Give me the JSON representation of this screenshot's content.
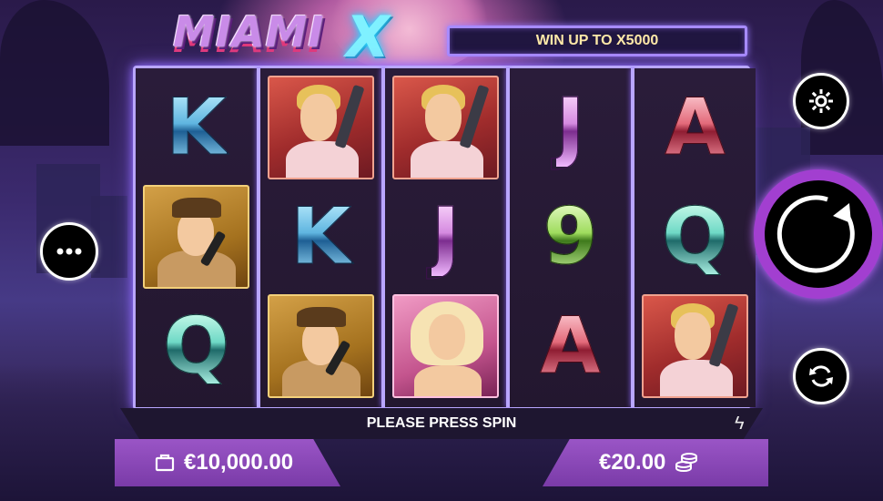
{
  "game": {
    "logo_main": "MIAMI",
    "logo_x": "X",
    "banner": "WIN UP TO X5000"
  },
  "reels": [
    [
      {
        "type": "letter",
        "value": "K"
      },
      {
        "type": "character",
        "name": "cop"
      },
      {
        "type": "letter",
        "value": "Q"
      }
    ],
    [
      {
        "type": "character",
        "name": "mobster"
      },
      {
        "type": "letter",
        "value": "K"
      },
      {
        "type": "character",
        "name": "cop"
      }
    ],
    [
      {
        "type": "character",
        "name": "mobster"
      },
      {
        "type": "letter",
        "value": "J"
      },
      {
        "type": "character",
        "name": "lady"
      }
    ],
    [
      {
        "type": "letter",
        "value": "J"
      },
      {
        "type": "letter",
        "value": "9"
      },
      {
        "type": "letter",
        "value": "A"
      }
    ],
    [
      {
        "type": "letter",
        "value": "A"
      },
      {
        "type": "letter",
        "value": "Q"
      },
      {
        "type": "character",
        "name": "mobster"
      }
    ]
  ],
  "status": {
    "message": "PLEASE PRESS SPIN",
    "balance": "€10,000.00",
    "bet": "€20.00"
  },
  "icons": {
    "settings": "gear-icon",
    "menu": "more-icon",
    "spin": "spin-icon",
    "autoplay": "autoplay-icon",
    "turbo": "lightning-icon",
    "balance": "wallet-icon",
    "bet": "coins-icon"
  },
  "colors": {
    "frame": "#b9a6ff",
    "accent_purple": "#a23fd0",
    "banner_text": "#ffe9a8"
  }
}
